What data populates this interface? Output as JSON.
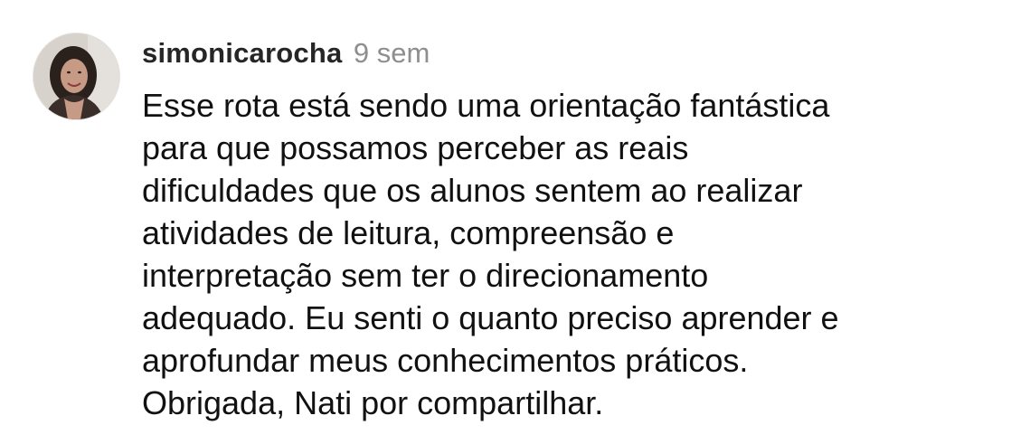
{
  "comment": {
    "username": "simonicarocha",
    "timestamp": "9 sem",
    "avatar_icon": "user-avatar-photo",
    "lines": [
      "Esse rota está sendo uma orientação fantástica",
      "para que possamos perceber as reais",
      "dificuldades que os alunos sentem ao realizar",
      "atividades de leitura, compreensão e",
      "interpretação sem ter o direcionamento",
      "adequado. Eu senti o quanto preciso aprender e",
      "aprofundar meus conhecimentos práticos.",
      "Obrigada, Nati por compartilhar."
    ]
  }
}
